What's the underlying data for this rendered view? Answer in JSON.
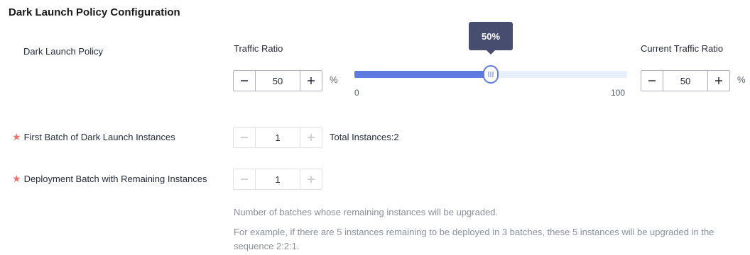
{
  "section": {
    "title": "Dark Launch Policy Configuration"
  },
  "policy": {
    "label": "Dark Launch Policy",
    "traffic_ratio": {
      "label": "Traffic Ratio",
      "value": "50",
      "unit": "%",
      "slider": {
        "value": 50,
        "min_label": "0",
        "max_label": "100",
        "tooltip": "50%"
      }
    },
    "current_traffic_ratio": {
      "label": "Current Traffic Ratio",
      "value": "50",
      "unit": "%"
    }
  },
  "first_batch": {
    "required_mark": "★",
    "label": "First Batch of Dark Launch Instances",
    "value": "1",
    "total_instances": "Total Instances:2"
  },
  "remaining_batch": {
    "required_mark": "★",
    "label": "Deployment Batch with Remaining Instances",
    "value": "1",
    "help_line1": "Number of batches whose remaining instances will be upgraded.",
    "help_line2": "For example, if there are 5 instances remaining to be deployed in 3 batches, these 5 instances will be upgraded in the sequence 2:2:1."
  },
  "icons": {
    "minus": "minus-icon",
    "plus": "plus-icon",
    "grip": "grip-icon"
  },
  "colors": {
    "accent": "#5e7ce0",
    "required": "#f66f6a",
    "tooltip_bg": "#464d6e"
  }
}
